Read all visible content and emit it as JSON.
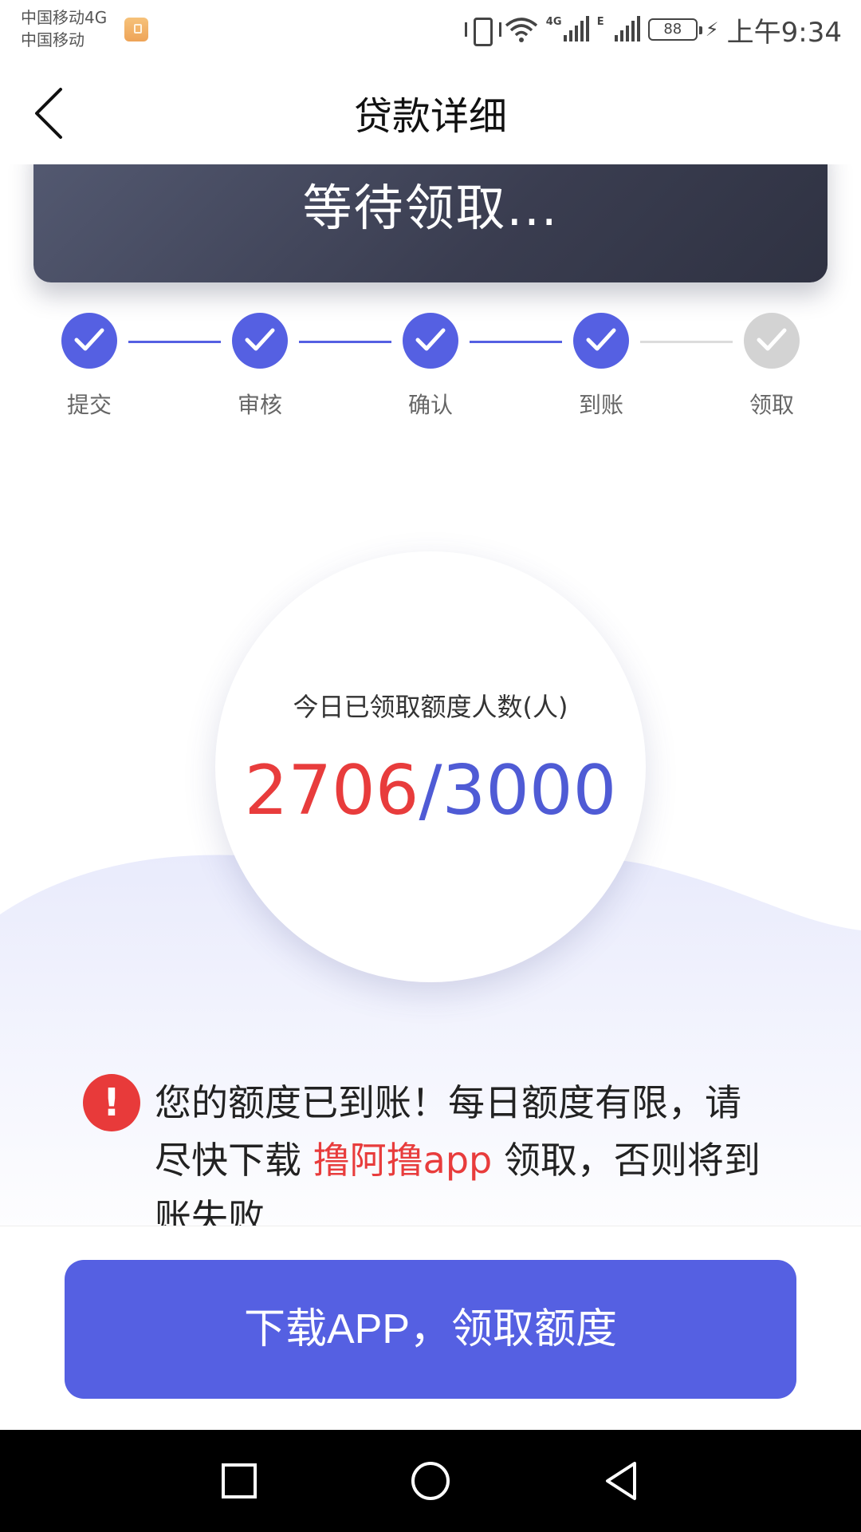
{
  "status_bar": {
    "carrier_line1": "中国移动4G",
    "carrier_line2": "中国移动",
    "signal1_label": "4G",
    "signal2_label": "E",
    "battery": "88",
    "time": "上午9:34"
  },
  "nav": {
    "title": "贷款详细",
    "back_icon": "back-arrow-icon"
  },
  "banner": {
    "status_text": "等待领取..."
  },
  "steps": [
    {
      "label": "提交",
      "done": true
    },
    {
      "label": "审核",
      "done": true
    },
    {
      "label": "确认",
      "done": true
    },
    {
      "label": "到账",
      "done": true
    },
    {
      "label": "领取",
      "done": false
    }
  ],
  "counter": {
    "label": "今日已领取额度人数(人)",
    "claimed": "2706",
    "separator": "/",
    "total": "3000"
  },
  "notice": {
    "icon_text": "!",
    "text_before": "您的额度已到账！每日额度有限，请尽快下载 ",
    "app_name": "撸阿撸app",
    "text_after": " 领取，否则将到账失败"
  },
  "action": {
    "button_label": "下载APP，领取额度"
  },
  "colors": {
    "accent": "#5560e2",
    "alert_red": "#e83c3c",
    "banner_dark": "#3a3d50",
    "pending_gray": "#d3d3d3"
  }
}
